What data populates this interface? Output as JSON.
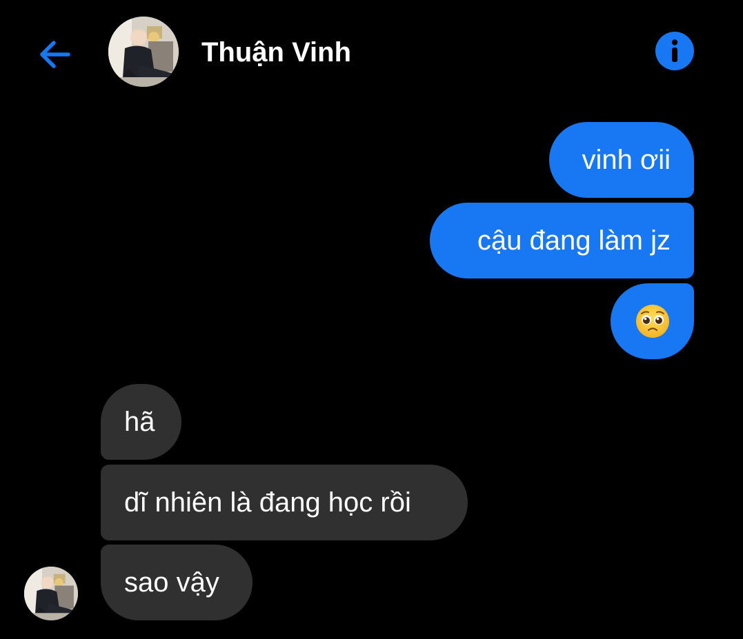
{
  "header": {
    "back_icon": "arrow-left-icon",
    "contact_name": "Thuận Vinh",
    "info_icon": "info-icon",
    "accent_color": "#1877f2"
  },
  "messages": [
    {
      "from": "me",
      "text": "vinh ơii"
    },
    {
      "from": "me",
      "text": "cậu đang làm jz"
    },
    {
      "from": "me",
      "emoji": "pleading-face-emoji"
    },
    {
      "from": "contact",
      "text": "hã"
    },
    {
      "from": "contact",
      "text": "dĩ nhiên là đang học rồi"
    },
    {
      "from": "contact",
      "text": "sao vậy"
    }
  ],
  "colors": {
    "background": "#000000",
    "outgoing_bubble": "#1877f2",
    "incoming_bubble": "#303030",
    "text": "#ffffff"
  }
}
